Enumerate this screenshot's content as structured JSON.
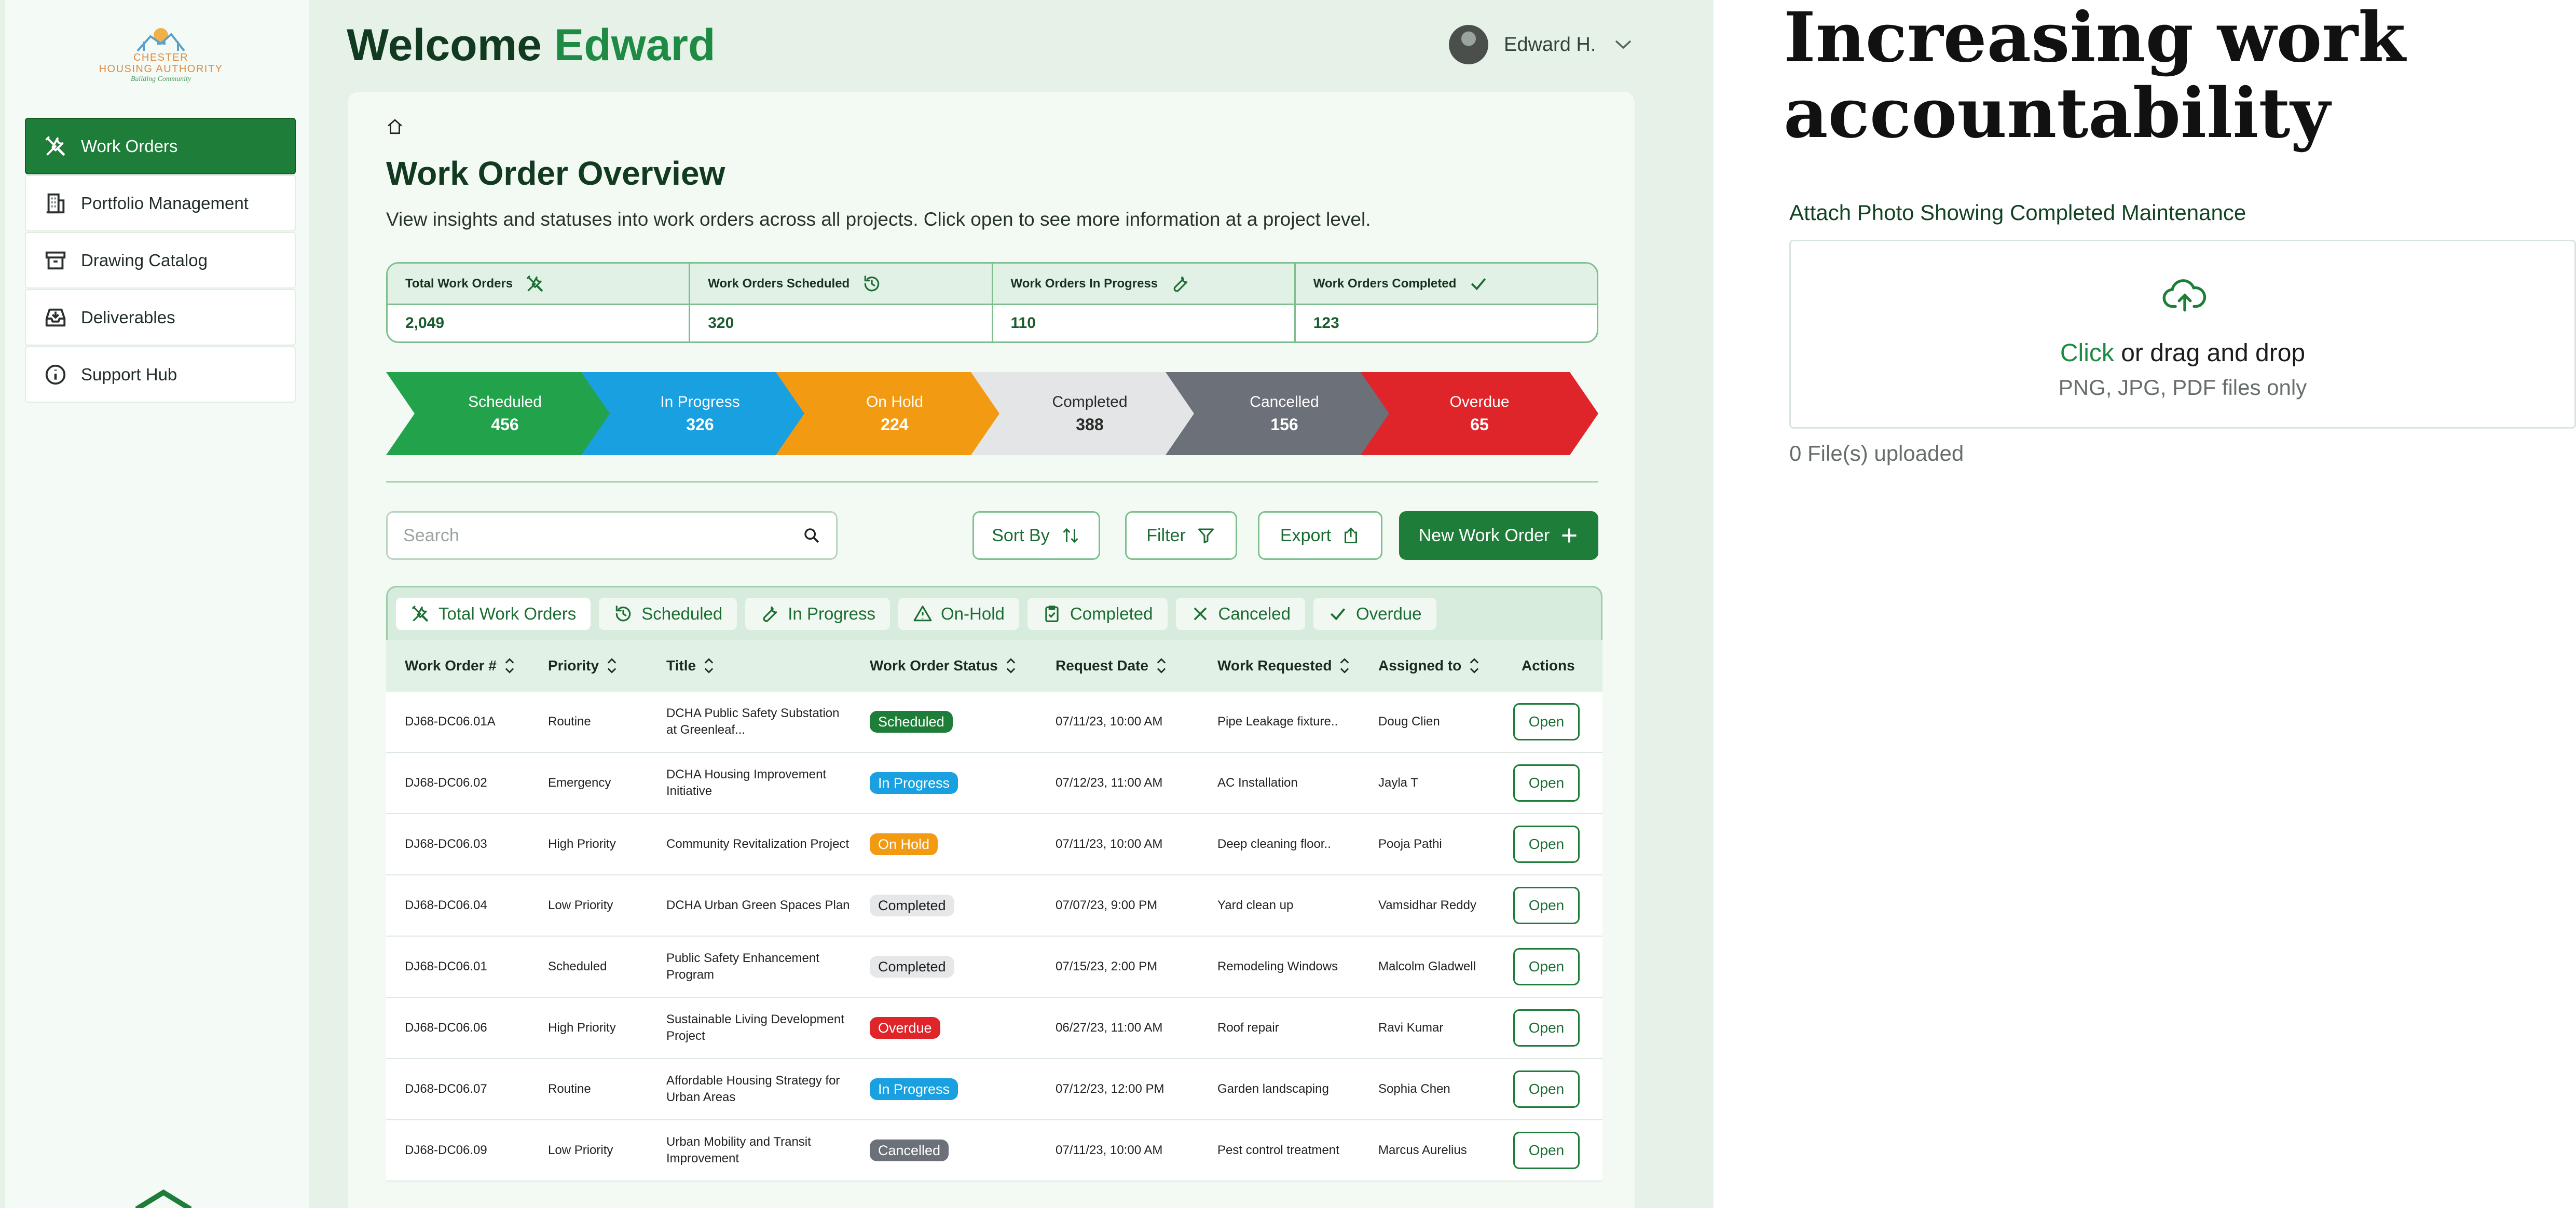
{
  "logo": {
    "line1": "CHESTER",
    "line2": "HOUSING AUTHORITY",
    "tagline": "Building Community"
  },
  "sidebar": {
    "items": [
      {
        "label": "Work Orders",
        "icon": "tools-icon",
        "active": true
      },
      {
        "label": "Portfolio Management",
        "icon": "building-icon",
        "active": false
      },
      {
        "label": "Drawing Catalog",
        "icon": "archive-icon",
        "active": false
      },
      {
        "label": "Deliverables",
        "icon": "inbox-icon",
        "active": false
      },
      {
        "label": "Support Hub",
        "icon": "info-icon",
        "active": false
      }
    ]
  },
  "header": {
    "welcome": "Welcome",
    "name": "Edward",
    "user_name": "Edward H."
  },
  "overview": {
    "title": "Work Order Overview",
    "description": "View insights and statuses into work orders across all projects. Click open to see more information at a project level.",
    "stats": [
      {
        "label": "Total Work Orders",
        "value": "2,049",
        "icon": "tools-icon"
      },
      {
        "label": "Work Orders Scheduled",
        "value": "320",
        "icon": "history-icon"
      },
      {
        "label": "Work Orders In Progress",
        "value": "110",
        "icon": "wrench-icon"
      },
      {
        "label": "Work Orders Completed",
        "value": "123",
        "icon": "check-icon"
      }
    ],
    "pipeline": [
      {
        "label": "Scheduled",
        "value": "456",
        "color": "#22a24a",
        "text": "#ffffff"
      },
      {
        "label": "In Progress",
        "value": "326",
        "color": "#18a0e0",
        "text": "#ffffff"
      },
      {
        "label": "On Hold",
        "value": "224",
        "color": "#f29a12",
        "text": "#ffffff"
      },
      {
        "label": "Completed",
        "value": "388",
        "color": "#e4e5e6",
        "text": "#2a2a2a"
      },
      {
        "label": "Cancelled",
        "value": "156",
        "color": "#6c7078",
        "text": "#ffffff"
      },
      {
        "label": "Overdue",
        "value": "65",
        "color": "#e0252a",
        "text": "#ffffff"
      }
    ]
  },
  "toolbar": {
    "search_placeholder": "Search",
    "sort_label": "Sort By",
    "filter_label": "Filter",
    "export_label": "Export",
    "new_label": "New Work Order"
  },
  "tabs": [
    {
      "label": "Total Work Orders",
      "icon": "tools-icon"
    },
    {
      "label": "Scheduled",
      "icon": "history-icon"
    },
    {
      "label": "In Progress",
      "icon": "wrench-icon"
    },
    {
      "label": "On-Hold",
      "icon": "warning-icon"
    },
    {
      "label": "Completed",
      "icon": "clipboard-check-icon"
    },
    {
      "label": "Canceled",
      "icon": "close-icon"
    },
    {
      "label": "Overdue",
      "icon": "check-icon"
    }
  ],
  "table": {
    "columns": [
      "Work Order #",
      "Priority",
      "Title",
      "Work Order Status",
      "Request Date",
      "Work Requested",
      "Assigned to",
      "Actions"
    ],
    "open_label": "Open",
    "status_colors": {
      "Scheduled": {
        "bg": "#1e7d38",
        "fg": "#ffffff"
      },
      "In Progress": {
        "bg": "#18a0e0",
        "fg": "#ffffff"
      },
      "On Hold": {
        "bg": "#f29a12",
        "fg": "#ffffff"
      },
      "Completed": {
        "bg": "#e6e7e8",
        "fg": "#1c1c1c"
      },
      "Overdue": {
        "bg": "#e0252a",
        "fg": "#ffffff"
      },
      "Cancelled": {
        "bg": "#6c7078",
        "fg": "#ffffff"
      }
    },
    "rows": [
      {
        "id": "DJ68-DC06.01A",
        "priority": "Routine",
        "title": "DCHA Public Safety Substation at Greenleaf...",
        "status": "Scheduled",
        "date": "07/11/23, 10:00 AM",
        "work": "Pipe Leakage fixture..",
        "assigned": "Doug Clien"
      },
      {
        "id": "DJ68-DC06.02",
        "priority": "Emergency",
        "title": "DCHA Housing Improvement Initiative",
        "status": "In Progress",
        "date": "07/12/23, 11:00 AM",
        "work": "AC Installation",
        "assigned": "Jayla T"
      },
      {
        "id": "DJ68-DC06.03",
        "priority": "High Priority",
        "title": "Community Revitalization Project",
        "status": "On Hold",
        "date": "07/11/23, 10:00 AM",
        "work": "Deep cleaning floor..",
        "assigned": "Pooja Pathi"
      },
      {
        "id": "DJ68-DC06.04",
        "priority": "Low Priority",
        "title": "DCHA Urban Green Spaces Plan",
        "status": "Completed",
        "date": "07/07/23, 9:00 PM",
        "work": "Yard clean up",
        "assigned": "Vamsidhar Reddy"
      },
      {
        "id": "DJ68-DC06.01",
        "priority": "Scheduled",
        "title": "Public Safety Enhancement Program",
        "status": "Completed",
        "date": "07/15/23, 2:00 PM",
        "work": "Remodeling Windows",
        "assigned": "Malcolm Gladwell"
      },
      {
        "id": "DJ68-DC06.06",
        "priority": "High Priority",
        "title": "Sustainable Living Development Project",
        "status": "Overdue",
        "date": "06/27/23, 11:00 AM",
        "work": "Roof repair",
        "assigned": "Ravi Kumar"
      },
      {
        "id": "DJ68-DC06.07",
        "priority": "Routine",
        "title": "Affordable Housing Strategy for Urban Areas",
        "status": "In Progress",
        "date": "07/12/23, 12:00 PM",
        "work": "Garden landscaping",
        "assigned": "Sophia Chen"
      },
      {
        "id": "DJ68-DC06.09",
        "priority": "Low Priority",
        "title": "Urban Mobility and Transit Improvement",
        "status": "Cancelled",
        "date": "07/11/23, 10:00 AM",
        "work": "Pest control treatment",
        "assigned": "Marcus Aurelius"
      }
    ]
  },
  "right": {
    "headline": "Increasing work accountability",
    "attach_label": "Attach Photo Showing Completed Maintenance",
    "dz_click": "Click",
    "dz_rest": " or drag and drop",
    "dz_formats": "PNG, JPG, PDF files only",
    "upload_count": "0 File(s) uploaded"
  },
  "colors": {
    "brand_green": "#1e7d38",
    "accent_green": "#1e8a43",
    "panel_bg": "#e6f2e8"
  }
}
